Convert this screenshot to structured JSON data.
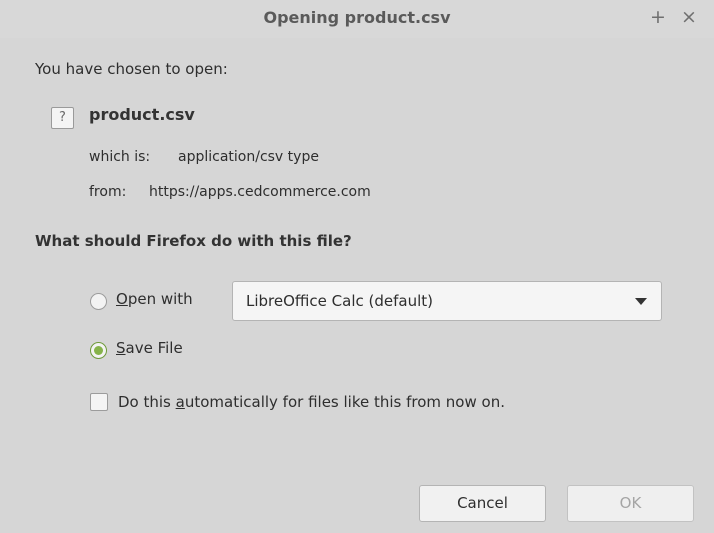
{
  "window": {
    "title": "Opening product.csv",
    "maximize_glyph": "+",
    "close_glyph": "×"
  },
  "dialog": {
    "intro": "You have chosen to open:",
    "file": {
      "icon": "unknown-file-icon",
      "icon_glyph": "?",
      "name": "product.csv"
    },
    "type_label": "which is:",
    "type_value": "application/csv type",
    "from_label": "from:",
    "from_value": "https://apps.cedcommerce.com",
    "question": "What should Firefox do with this file?",
    "options": {
      "open_with": {
        "label_mnemonic": "O",
        "label_rest": "pen with",
        "selected": false,
        "application": "LibreOffice Calc (default)"
      },
      "save_file": {
        "label_mnemonic": "S",
        "label_rest": "ave File",
        "selected": true
      }
    },
    "auto_checkbox": {
      "label_before": "Do this ",
      "label_mnemonic": "a",
      "label_after": "utomatically for files like this from now on.",
      "checked": false
    },
    "buttons": {
      "cancel": "Cancel",
      "ok": "OK",
      "ok_enabled": false
    }
  },
  "colors": {
    "background": "#d6d6d6",
    "accent_radio": "#86b34a",
    "disabled_text": "#a5a5a5"
  }
}
